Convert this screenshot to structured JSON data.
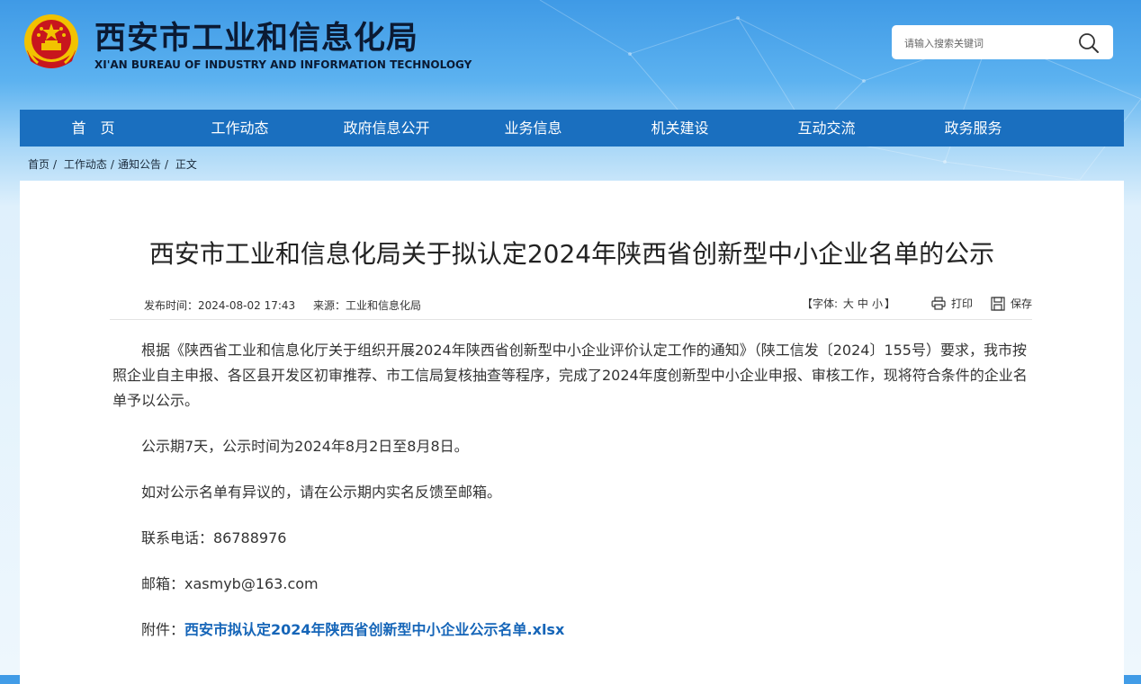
{
  "header": {
    "title_cn": "西安市工业和信息化局",
    "title_en": "XI'AN BUREAU OF INDUSTRY AND INFORMATION TECHNOLOGY",
    "search_placeholder": "请输入搜索关键词",
    "emblem_icon": "national-emblem-icon",
    "search_icon": "search-icon"
  },
  "nav": {
    "items": [
      "首　页",
      "工作动态",
      "政府信息公开",
      "业务信息",
      "机关建设",
      "互动交流",
      "政务服务"
    ]
  },
  "breadcrumb": [
    "首页",
    "工作动态",
    "通知公告",
    "正文"
  ],
  "article": {
    "title": "西安市工业和信息化局关于拟认定2024年陕西省创新型中小企业名单的公示",
    "publish_label": "发布时间：",
    "publish_time": "2024-08-02 17:43",
    "source_label": "来源：",
    "source": "工业和信息化局",
    "font_label_prefix": "【字体:",
    "font_sizes": [
      "大",
      "中",
      "小"
    ],
    "font_label_suffix": "】",
    "print_label": "打印",
    "save_label": "保存",
    "paragraphs": [
      "根据《陕西省工业和信息化厅关于组织开展2024年陕西省创新型中小企业评价认定工作的通知》（陕工信发〔2024〕155号）要求，我市按照企业自主申报、各区县开发区初审推荐、市工信局复核抽查等程序，完成了2024年度创新型中小企业申报、审核工作，现将符合条件的企业名单予以公示。",
      "公示期7天，公示时间为2024年8月2日至8月8日。",
      "如对公示名单有异议的，请在公示期内实名反馈至邮箱。",
      "联系电话：86788976",
      "邮箱：xasmyb@163.com"
    ],
    "attachment_label": "附件：",
    "attachment_name": "西安市拟认定2024年陕西省创新型中小企业公示名单.xlsx"
  },
  "colors": {
    "nav_bg": "#1a6fbf",
    "link": "#1565b8",
    "emblem_red": "#c8161d",
    "emblem_gold": "#f2c200"
  }
}
